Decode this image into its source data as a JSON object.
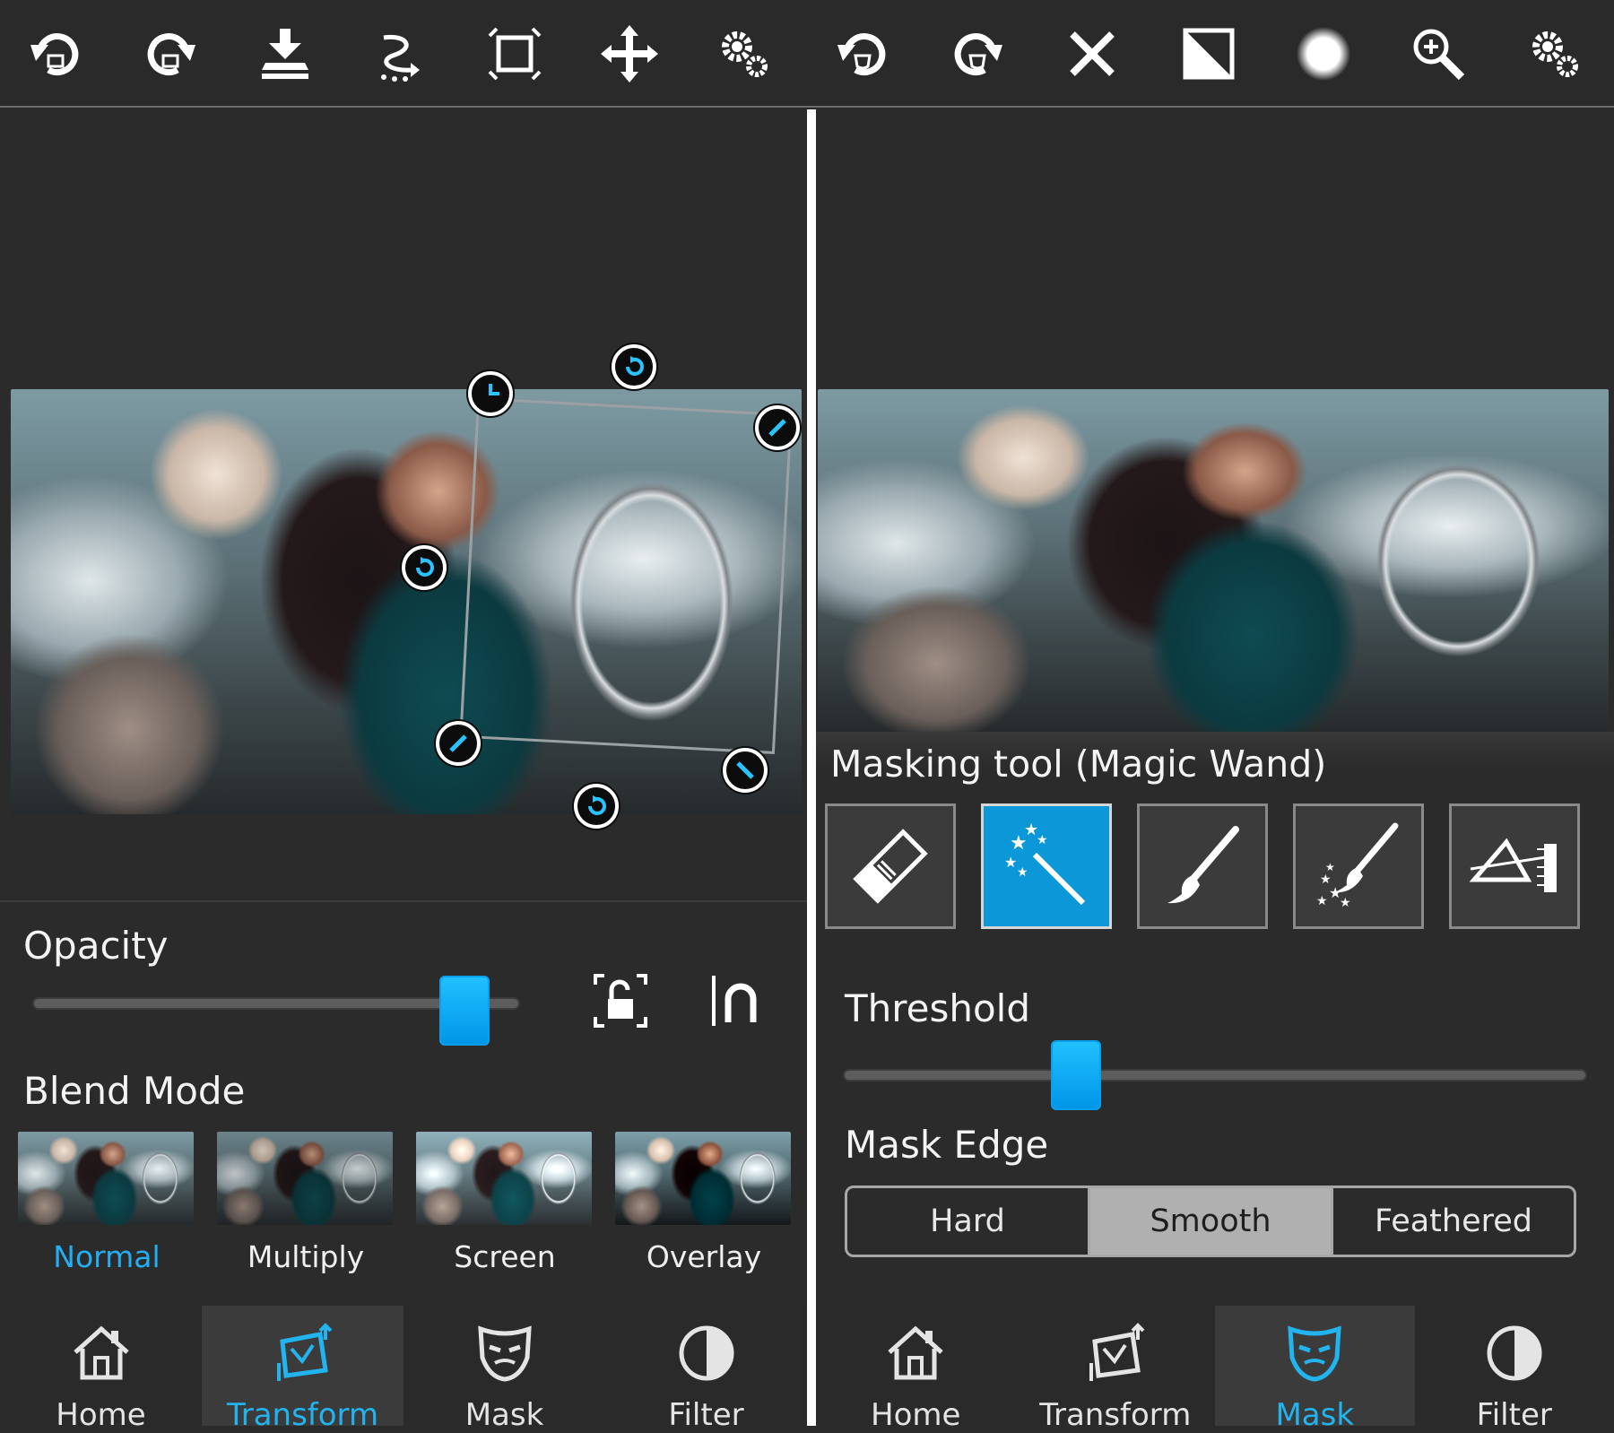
{
  "toolbar": {
    "icons": [
      "undo-icon",
      "redo-icon",
      "import-icon",
      "flip-icon",
      "fit-frame-icon",
      "move-icon",
      "settings-icon",
      "undo-mask-icon",
      "redo-mask-icon",
      "close-icon",
      "invert-icon",
      "brush-size-icon",
      "zoom-icon",
      "settings-icon"
    ]
  },
  "left_panel": {
    "opacity_label": "Opacity",
    "opacity_value": 0.93,
    "blend_mode_label": "Blend Mode",
    "blend_modes": [
      "Normal",
      "Multiply",
      "Screen",
      "Overlay"
    ],
    "selected_blend": "Normal",
    "nav": [
      "Home",
      "Transform",
      "Mask",
      "Filter"
    ],
    "active_nav": "Transform"
  },
  "right_panel": {
    "masking_tool_label": "Masking tool (Magic Wand)",
    "tools": [
      "eraser-tool",
      "magic-wand-tool",
      "brush-tool",
      "spray-brush-tool",
      "gradient-tool"
    ],
    "active_tool": "magic-wand-tool",
    "threshold_label": "Threshold",
    "threshold_value": 0.3,
    "mask_edge_label": "Mask Edge",
    "mask_edge_options": [
      "Hard",
      "Smooth",
      "Feathered"
    ],
    "selected_edge": "Smooth",
    "nav": [
      "Home",
      "Transform",
      "Mask",
      "Filter"
    ],
    "active_nav": "Mask"
  },
  "colors": {
    "accent": "#0b97d8",
    "accent_text": "#22aef0",
    "background": "#2b2b2c"
  }
}
